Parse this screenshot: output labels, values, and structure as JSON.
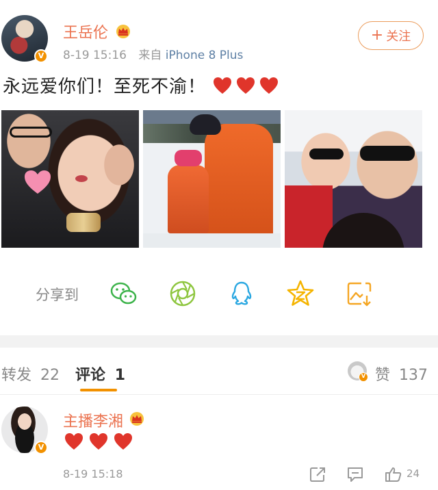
{
  "post": {
    "username": "王岳伦",
    "time": "8-19 15:16",
    "source_prefix": "来自",
    "source": "iPhone 8 Plus",
    "follow_label": "关注",
    "text": "永远爱你们！至死不渝！",
    "hearts": [
      "heart",
      "heart",
      "heart"
    ],
    "photos": [
      {
        "subject": "couple-selfie"
      },
      {
        "subject": "ski-slope-father-daughter"
      },
      {
        "subject": "boat-selfie"
      }
    ]
  },
  "share": {
    "label": "分享到",
    "targets": [
      "wechat-icon",
      "moments-icon",
      "qq-icon",
      "qzone-icon",
      "save-image-icon"
    ]
  },
  "tabs": {
    "reposts_label": "转发",
    "reposts_count": "22",
    "comments_label": "评论",
    "comments_count": "1",
    "likes_label": "赞",
    "likes_count": "137"
  },
  "comment": {
    "username": "主播李湘",
    "hearts": [
      "heart",
      "heart",
      "heart"
    ],
    "time": "8-19 15:18",
    "like_count": "24"
  },
  "colors": {
    "accent": "#eb7350",
    "vip_gold": "#f29100",
    "heart": "#e0352b",
    "link": "#5d7fa4"
  }
}
